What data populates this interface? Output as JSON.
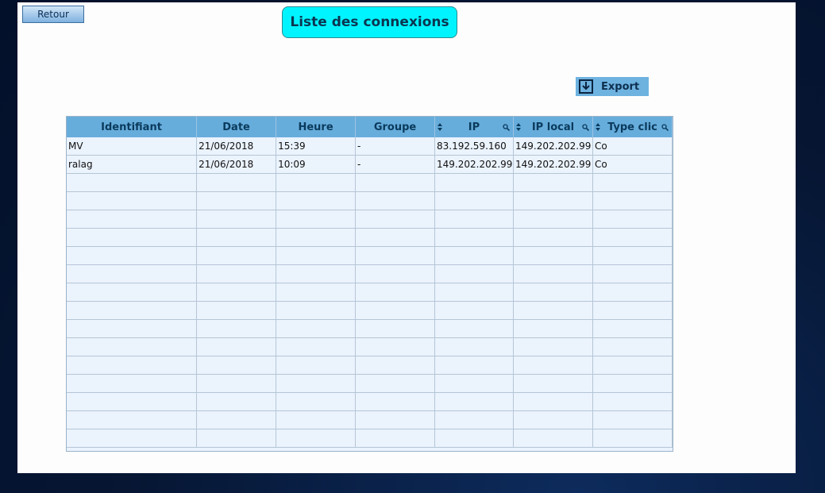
{
  "toolbar": {
    "back_label": "Retour",
    "export_label": "Export"
  },
  "page": {
    "title": "Liste des connexions"
  },
  "table": {
    "columns": {
      "identifiant": "Identifiant",
      "date": "Date",
      "heure": "Heure",
      "groupe": "Groupe",
      "ip": "IP",
      "ip_local": "IP local",
      "type_clic": "Type clic"
    },
    "rows": [
      {
        "identifiant": "MV",
        "date": "21/06/2018",
        "heure": "15:39",
        "groupe": "-",
        "ip": "83.192.59.160",
        "ip_local": "149.202.202.99",
        "type_clic": "Co"
      },
      {
        "identifiant": "ralag",
        "date": "21/06/2018",
        "heure": "10:09",
        "groupe": "-",
        "ip": "149.202.202.99",
        "ip_local": "149.202.202.99",
        "type_clic": "Co"
      }
    ]
  },
  "icons": {
    "export": "download-arrow-icon",
    "sort": "sort-arrows-icon",
    "filter": "magnifier-icon"
  },
  "colors": {
    "header": "#67addc",
    "title_bg": "#00f4ff",
    "row_bg": "#ebf3fd"
  }
}
